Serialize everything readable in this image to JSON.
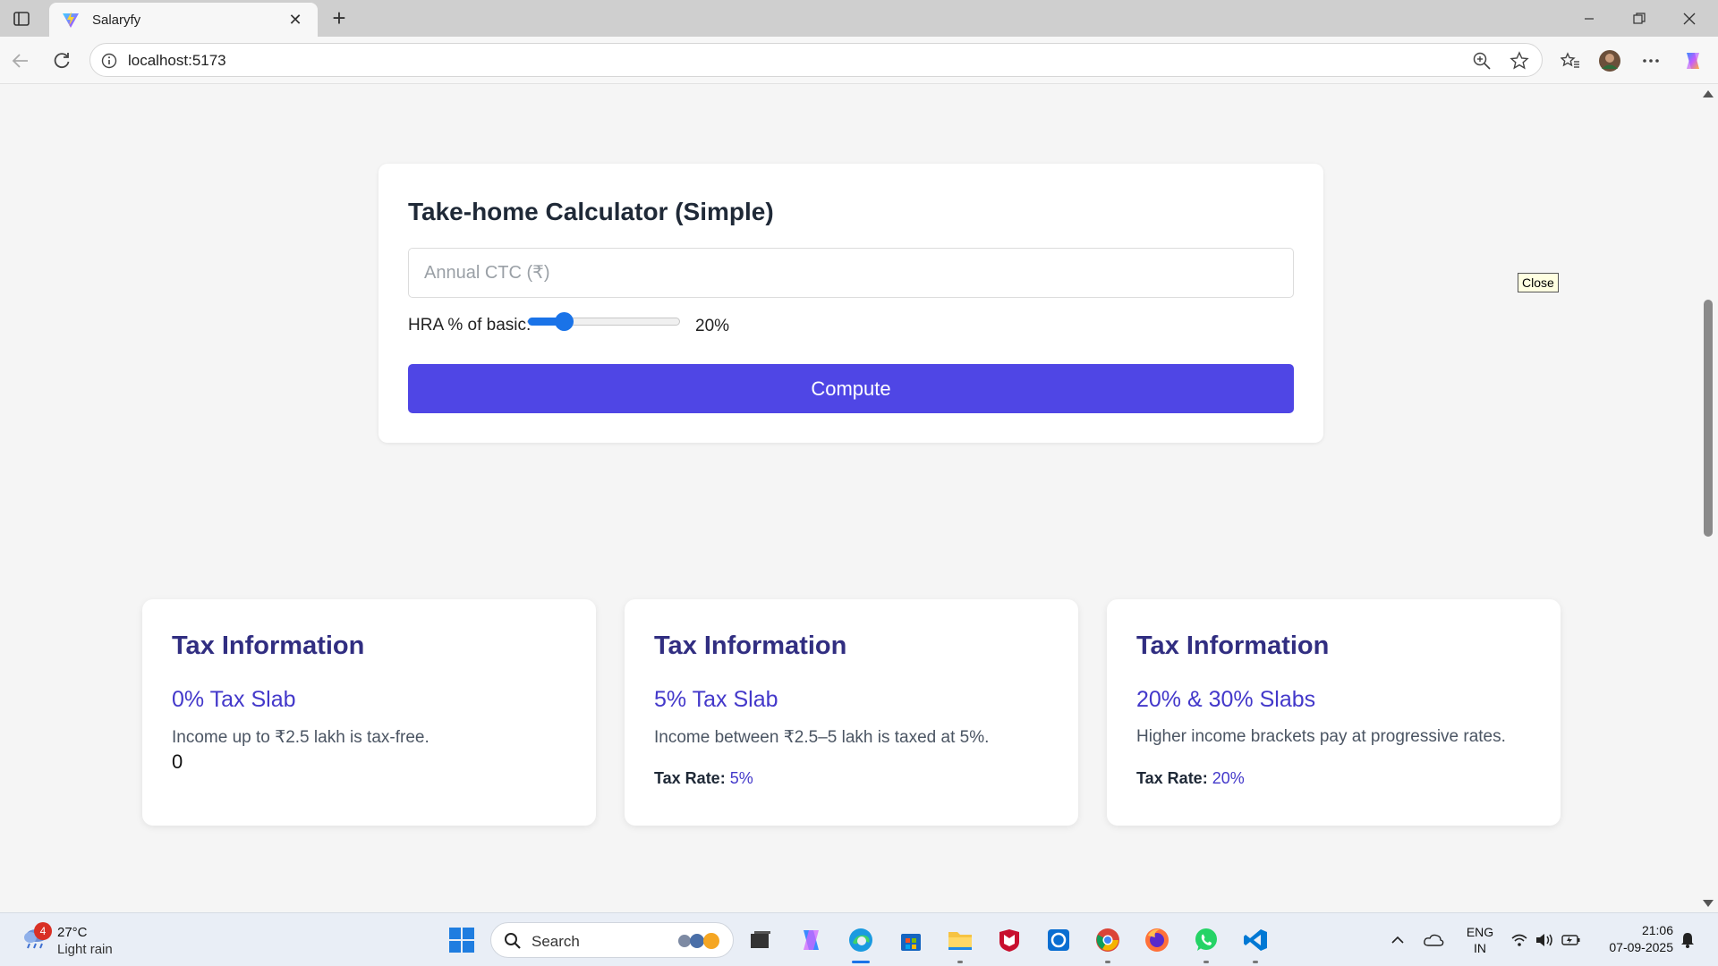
{
  "browser": {
    "tab_title": "Salaryfy",
    "url": "localhost:5173",
    "new_tab_label": "+",
    "tab_close_label": "✕"
  },
  "calculator": {
    "title": "Take-home Calculator (Simple)",
    "ctc_placeholder": "Annual CTC (₹)",
    "ctc_value": "",
    "hra_label": "HRA % of basic:",
    "hra_value_text": "20%",
    "hra_percent": 20,
    "hra_slider_min": 0,
    "hra_slider_max": 100,
    "compute_label": "Compute"
  },
  "tooltip": {
    "close_label": "Close"
  },
  "tax_cards": [
    {
      "title": "Tax Information",
      "subtitle": "0% Tax Slab",
      "description": "Income up to ₹2.5 lakh is tax-free.",
      "value": "0"
    },
    {
      "title": "Tax Information",
      "subtitle": "5% Tax Slab",
      "description": "Income between ₹2.5–5 lakh is taxed at 5%.",
      "rate_label": "Tax Rate:",
      "rate_value": "5%"
    },
    {
      "title": "Tax Information",
      "subtitle": "20% & 30% Slabs",
      "description": "Higher income brackets pay at progressive rates.",
      "rate_label": "Tax Rate:",
      "rate_value": "20%"
    }
  ],
  "taskbar": {
    "weather_badge": "4",
    "weather_temp": "27°C",
    "weather_condition": "Light rain",
    "search_label": "Search",
    "language_line1": "ENG",
    "language_line2": "IN",
    "time": "21:06",
    "date": "07-09-2025"
  },
  "colors": {
    "accent": "#4f46e5",
    "card_title": "#312e81",
    "card_subtitle": "#4338ca",
    "slider": "#1a73e8"
  }
}
